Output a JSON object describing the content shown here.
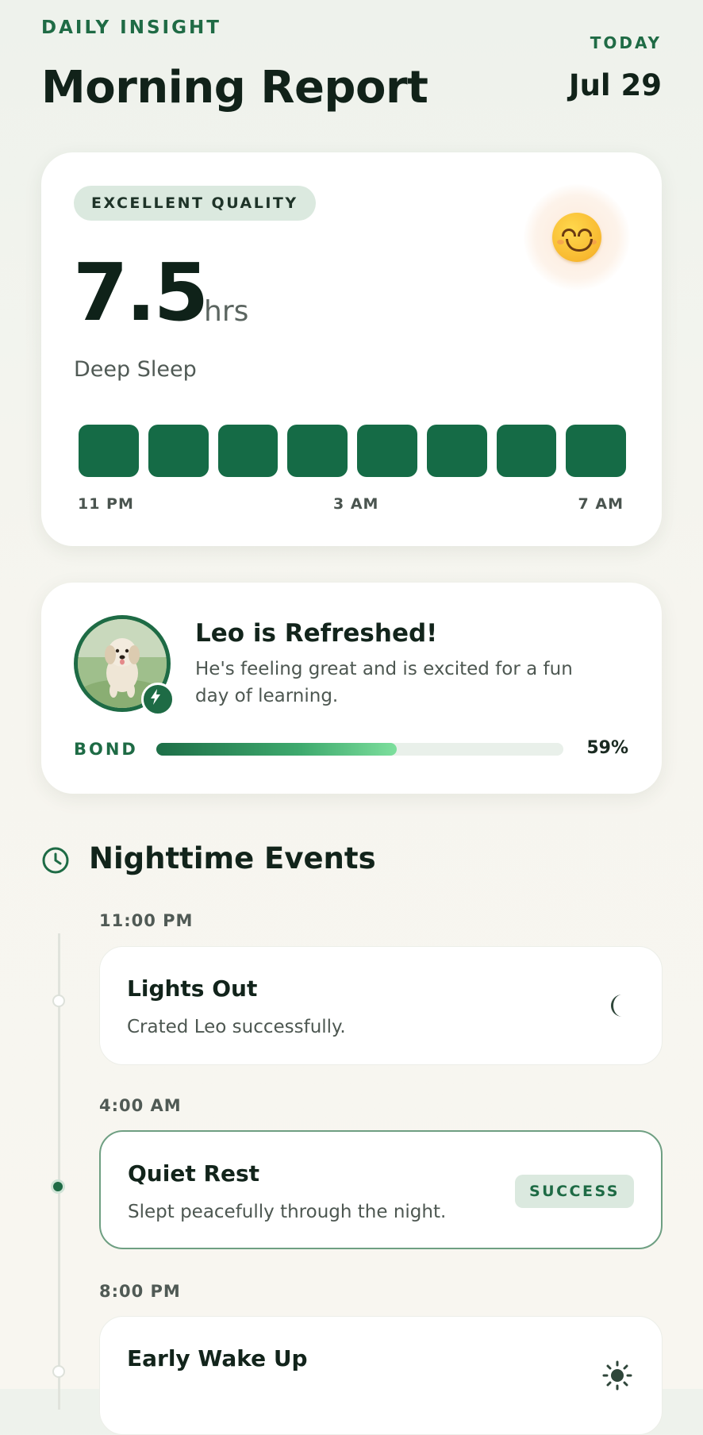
{
  "header": {
    "eyebrow": "DAILY INSIGHT",
    "title": "Morning Report",
    "today_label": "TODAY",
    "today_date": "Jul 29"
  },
  "sleep": {
    "quality_badge": "EXCELLENT QUALITY",
    "mood_icon": "smiling-face-emoji",
    "hours": "7.5",
    "unit": "hrs",
    "label": "Deep Sleep",
    "block_count": 8,
    "block_color": "#156b46",
    "ticks": [
      "11 PM",
      "3 AM",
      "7 AM"
    ]
  },
  "pet": {
    "title": "Leo is Refreshed!",
    "description": "He's feeling great and is excited for a fun day of learning.",
    "badge_icon": "bolt-icon",
    "bond_label": "BOND",
    "bond_percent": 59,
    "bond_text": "59%"
  },
  "events": {
    "section_title": "Nighttime Events",
    "section_icon": "clock-icon",
    "items": [
      {
        "time": "11:00 PM",
        "title": "Lights Out",
        "subtitle": "Crated Leo successfully.",
        "icon": "moon-icon"
      },
      {
        "time": "4:00 AM",
        "title": "Quiet Rest",
        "subtitle": "Slept peacefully through the night.",
        "badge": "SUCCESS"
      },
      {
        "time": "8:00 PM",
        "title": "Early Wake Up",
        "icon": "sun-icon"
      }
    ]
  },
  "colors": {
    "accent": "#1e6b45",
    "badge_bg": "#dbe9df",
    "text_dark": "#12241b"
  }
}
